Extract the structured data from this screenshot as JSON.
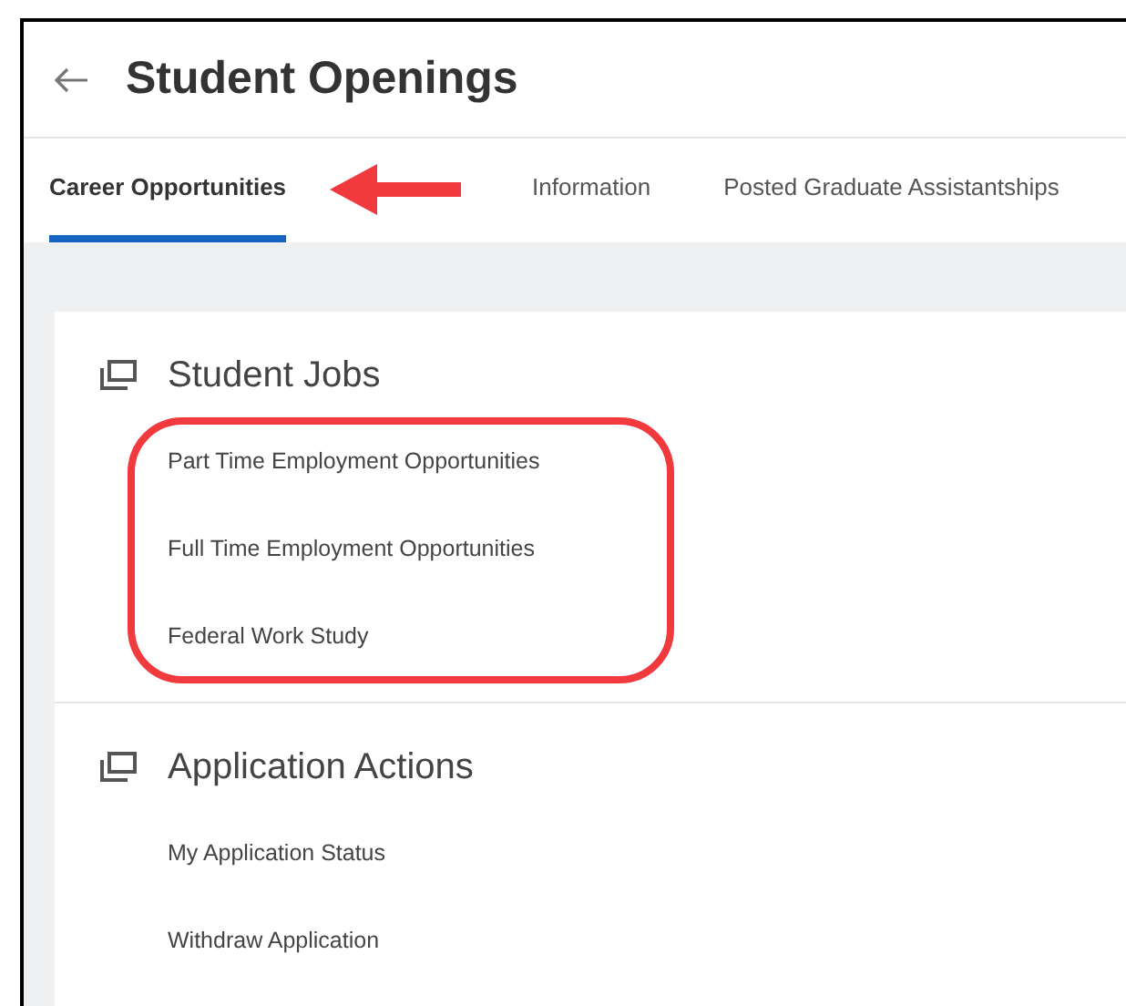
{
  "header": {
    "title": "Student Openings"
  },
  "tabs": [
    {
      "label": "Career Opportunities",
      "selected": true
    },
    {
      "label": "Information",
      "selected": false
    },
    {
      "label": "Posted Graduate Assistantships",
      "selected": false
    }
  ],
  "sections": [
    {
      "title": "Student Jobs",
      "highlighted": true,
      "links": [
        "Part Time Employment Opportunities",
        "Full Time Employment Opportunities",
        "Federal Work Study"
      ]
    },
    {
      "title": "Application Actions",
      "highlighted": false,
      "links": [
        "My Application Status",
        "Withdraw Application"
      ]
    }
  ]
}
